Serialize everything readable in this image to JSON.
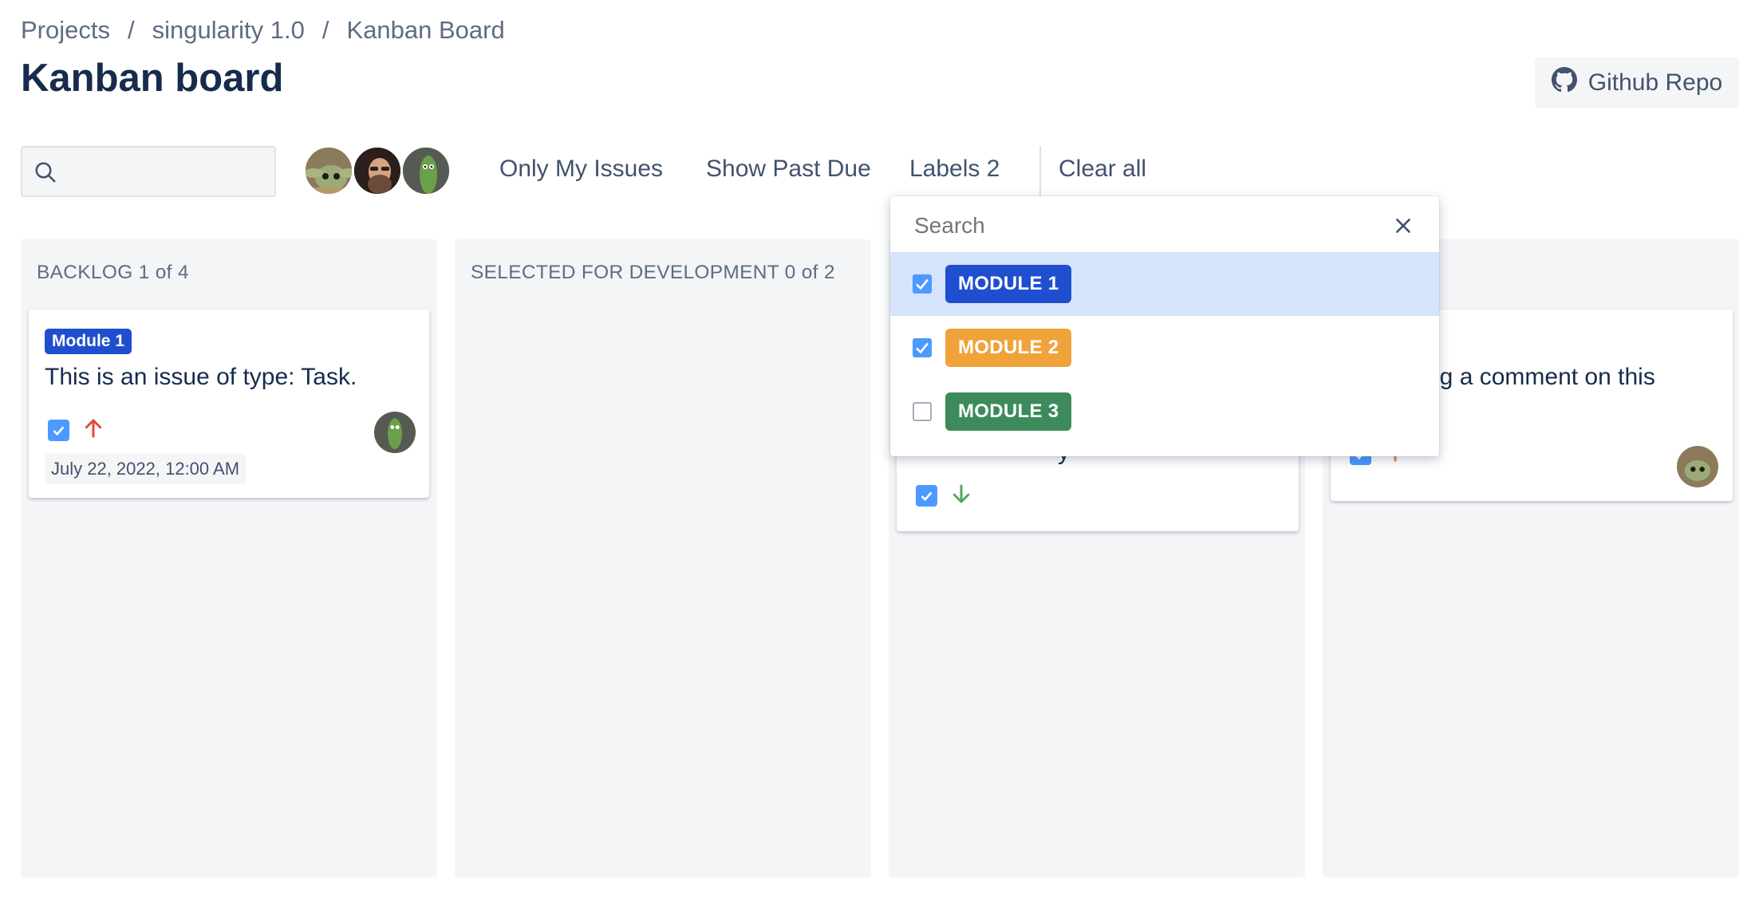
{
  "breadcrumb": {
    "items": [
      "Projects",
      "singularity 1.0",
      "Kanban Board"
    ],
    "separator": "/"
  },
  "page": {
    "title": "Kanban board"
  },
  "header": {
    "github_label": "Github Repo"
  },
  "filters": {
    "search_placeholder": "",
    "only_my_issues": "Only My Issues",
    "show_past_due": "Show Past Due",
    "labels": "Labels 2",
    "clear_all": "Clear all",
    "avatars": [
      "baby-yoda-avatar",
      "bearded-man-avatar",
      "pickle-avatar"
    ]
  },
  "columns": [
    {
      "title": "BACKLOG 1 of 4",
      "cards": [
        {
          "label": "Module 1",
          "title": "This is an issue of type: Task.",
          "priority_icon": "arrow-up-icon",
          "priority_color": "#e5493a",
          "date": "July 22, 2022, 12:00 AM"
        }
      ]
    },
    {
      "title": "SELECTED FOR DEVELOPMENT 0 of 2",
      "cards": []
    },
    {
      "title": "",
      "cards": [
        {
          "title_fragment": "y",
          "priority_icon": "arrow-down-icon",
          "priority_color": "#57a55a"
        }
      ]
    },
    {
      "title": "",
      "cards": [
        {
          "title_line1": "ng a comment on this",
          "priority_icon": "arrow-up-icon",
          "priority_color": "#e97f33"
        }
      ]
    }
  ],
  "label_dropdown": {
    "search_placeholder": "Search",
    "options": [
      {
        "label": "MODULE 1",
        "checked": true,
        "color": "#1f4fcf"
      },
      {
        "label": "MODULE 2",
        "checked": true,
        "color": "#f0a33b"
      },
      {
        "label": "MODULE 3",
        "checked": false,
        "color": "#3d8b5c"
      }
    ]
  },
  "colors": {
    "accent": "#4c9aff",
    "text": "#172b4d",
    "muted": "#5e6c84",
    "column_bg": "#f4f5f7",
    "selected_bg": "#d6e4fb"
  }
}
